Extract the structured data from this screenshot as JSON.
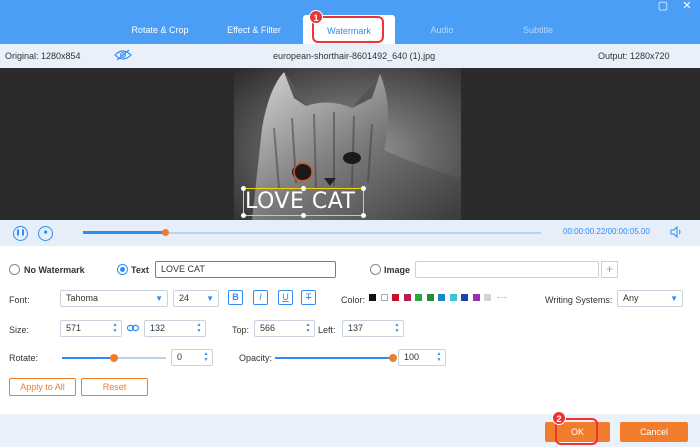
{
  "tabs": [
    {
      "label": "Rotate & Crop"
    },
    {
      "label": "Effect & Filter"
    },
    {
      "label": "Watermark"
    },
    {
      "label": "Audio"
    },
    {
      "label": "Subtitle"
    }
  ],
  "annotations": {
    "step1": "1",
    "step2": "2"
  },
  "info": {
    "original": "Original: 1280x854",
    "filename": "european-shorthair-8601492_640 (1).jpg",
    "output": "Output: 1280x720"
  },
  "preview": {
    "watermark_text": "LOVE CAT"
  },
  "player": {
    "current_time": "00:00:00.22",
    "separator": "/",
    "total_time": "00:00:05.00",
    "progress": 0.18
  },
  "watermark": {
    "none_label": "No Watermark",
    "text_label": "Text",
    "text_value": "LOVE CAT",
    "image_label": "Image",
    "image_value": "",
    "add_image": "+"
  },
  "font": {
    "label": "Font:",
    "family": "Tahoma",
    "size": "24",
    "bold": "B",
    "italic": "I",
    "underline": "U",
    "strike": "T",
    "color_label": "Color:",
    "colors": [
      "#111111",
      "#ffffff",
      "#c0122f",
      "#b51e56",
      "#2aa63a",
      "#1f8d33",
      "#1c86c9",
      "#3dc4d6",
      "#1e43a8",
      "#9b2fb4",
      "#d4d4d4"
    ],
    "more_colors": "···",
    "writing_label": "Writing Systems:",
    "writing_value": "Any"
  },
  "size": {
    "label": "Size:",
    "width": "571",
    "height": "132",
    "top_label": "Top:",
    "top": "566",
    "left_label": "Left:",
    "left": "137"
  },
  "rotate": {
    "label": "Rotate:",
    "value": "0",
    "level": 0.5
  },
  "opacity": {
    "label": "Opacity:",
    "value": "100",
    "level": 1.0
  },
  "actions": {
    "apply_all": "Apply to All",
    "reset": "Reset"
  },
  "footer": {
    "ok": "OK",
    "cancel": "Cancel"
  },
  "colors": {
    "accent": "#2f8cf5",
    "orange": "#f07c2c",
    "callout": "#e33333"
  }
}
